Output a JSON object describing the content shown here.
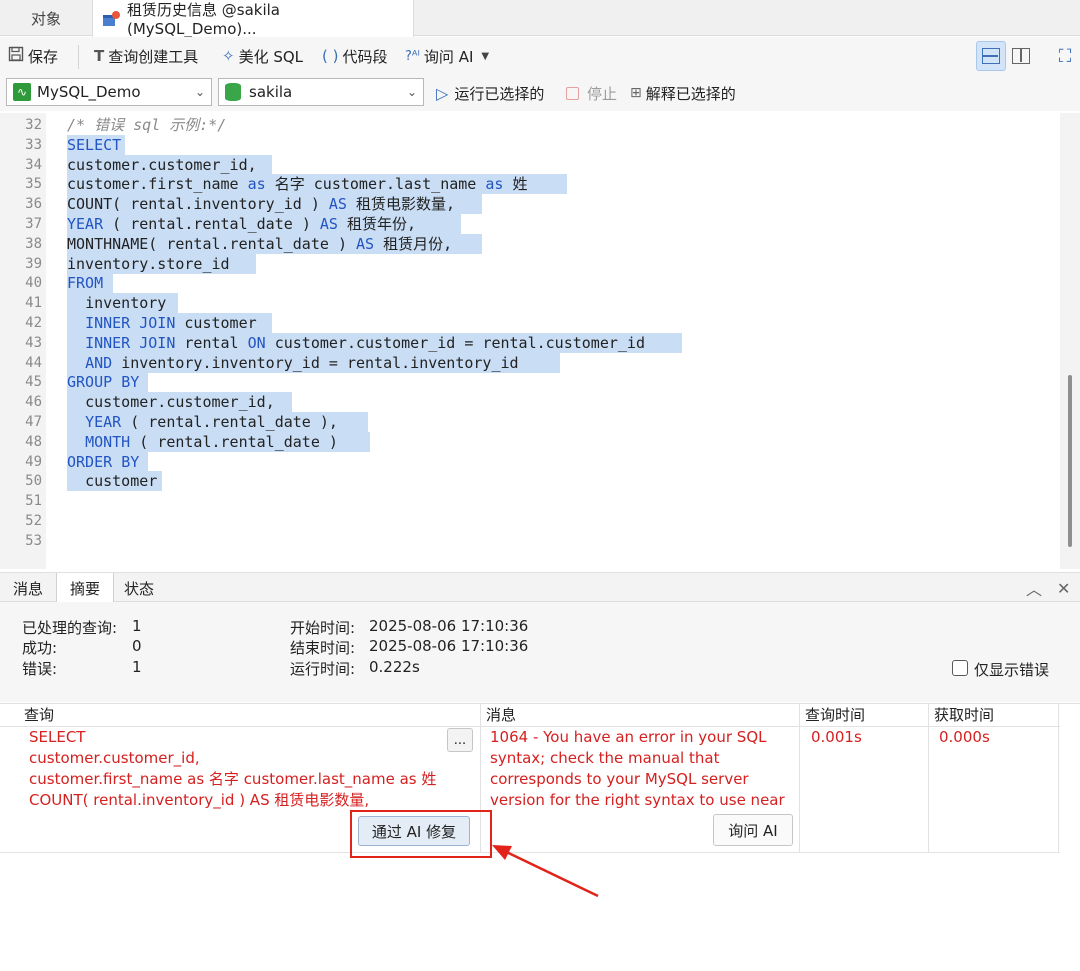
{
  "tabs": {
    "objects": "对象",
    "rental": "租赁历史信息 @sakila (MySQL_Demo)..."
  },
  "toolbar": {
    "save": "保存",
    "query_builder": "查询创建工具",
    "beautify": "美化 SQL",
    "snippet": "代码段",
    "ask_ai": "询问 AI"
  },
  "connbar": {
    "connection": "MySQL_Demo",
    "database": "sakila",
    "run_selected": "运行已选择的",
    "stop": "停止",
    "explain_selected": "解释已选择的"
  },
  "editor": {
    "lines": [
      {
        "n": "32",
        "text": "/* 错误 sql 示例:*/"
      },
      {
        "n": "33",
        "text": "SELECT"
      },
      {
        "n": "34",
        "text": "customer.customer_id,"
      },
      {
        "n": "35",
        "text": "customer.first_name as 名字 customer.last_name as 姓"
      },
      {
        "n": "36",
        "text": "COUNT( rental.inventory_id ) AS 租赁电影数量,"
      },
      {
        "n": "37",
        "text": "YEAR ( rental.rental_date ) AS 租赁年份,"
      },
      {
        "n": "38",
        "text": "MONTHNAME( rental.rental_date ) AS 租赁月份,"
      },
      {
        "n": "39",
        "text": "inventory.store_id"
      },
      {
        "n": "40",
        "text": "FROM"
      },
      {
        "n": "41",
        "text": "  inventory"
      },
      {
        "n": "42",
        "text": "  INNER JOIN customer"
      },
      {
        "n": "43",
        "text": "  INNER JOIN rental ON customer.customer_id = rental.customer_id"
      },
      {
        "n": "44",
        "text": "  AND inventory.inventory_id = rental.inventory_id"
      },
      {
        "n": "45",
        "text": "GROUP BY"
      },
      {
        "n": "46",
        "text": "  customer.customer_id,"
      },
      {
        "n": "47",
        "text": "  YEAR ( rental.rental_date ),"
      },
      {
        "n": "48",
        "text": "  MONTH ( rental.rental_date )"
      },
      {
        "n": "49",
        "text": "ORDER BY"
      },
      {
        "n": "50",
        "text": "  customer"
      },
      {
        "n": "51",
        "text": ""
      },
      {
        "n": "52",
        "text": ""
      },
      {
        "n": "53",
        "text": ""
      }
    ]
  },
  "result_tabs": {
    "messages": "消息",
    "summary": "摘要",
    "status": "状态"
  },
  "summary": {
    "processed_label": "已处理的查询:",
    "processed_value": "1",
    "success_label": "成功:",
    "success_value": "0",
    "error_label": "错误:",
    "error_value": "1",
    "start_label": "开始时间:",
    "start_value": "2025-08-06 17:10:36",
    "end_label": "结束时间:",
    "end_value": "2025-08-06 17:10:36",
    "runtime_label": "运行时间:",
    "runtime_value": "0.222s",
    "only_errors_label": "仅显示错误"
  },
  "grid": {
    "headers": [
      "查询",
      "消息",
      "查询时间",
      "获取时间"
    ],
    "query_lines": [
      "SELECT",
      "customer.customer_id,",
      "customer.first_name as 名字 customer.last_name as 姓",
      "COUNT( rental.inventory_id ) AS 租赁电影数量,"
    ],
    "message_lines": [
      "1064 - You have an error in your SQL",
      "syntax; check the manual that",
      "corresponds to your MySQL server",
      "version for the right syntax to use near"
    ],
    "query_time": "0.001s",
    "fetch_time": "0.000s",
    "ellipsis": "...",
    "fix_ai": "通过 AI 修复",
    "ask_ai": "询问 AI"
  }
}
